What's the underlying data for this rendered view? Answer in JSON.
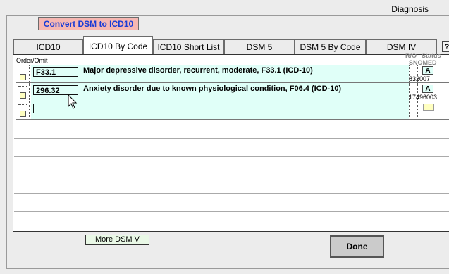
{
  "window": {
    "title": "Diagnosis"
  },
  "convert_button": {
    "label": "Convert DSM to ICD10"
  },
  "tabs": [
    {
      "label": "ICD10",
      "active": false
    },
    {
      "label": "ICD10 By Code",
      "active": true
    },
    {
      "label": "ICD10 Short List",
      "active": false
    },
    {
      "label": "DSM 5",
      "active": false
    },
    {
      "label": "DSM 5 By Code",
      "active": false
    },
    {
      "label": "DSM IV",
      "active": false
    }
  ],
  "help_button": {
    "label": "?"
  },
  "grid": {
    "headers": {
      "order_omit": "Order/Omit",
      "ro": "R/O",
      "status": "Status",
      "snomed": "SNOMED"
    },
    "rows": [
      {
        "code": "F33.1",
        "description": "Major depressive disorder, recurrent, moderate, F33.1 (ICD-10)",
        "status": "A",
        "snomed": "832007"
      },
      {
        "code": "296.32",
        "description": "Anxiety disorder due to known physiological condition, F06.4 (ICD-10)",
        "status": "A",
        "snomed": "17496003"
      },
      {
        "code": "",
        "description": "",
        "status": "",
        "snomed": ""
      }
    ]
  },
  "more_button": {
    "label": "More DSM V"
  },
  "done_button": {
    "label": "Done"
  },
  "colors": {
    "accent_row": "#e0fff8",
    "convert_bg": "#f6b7b2",
    "convert_text": "#1b3dd6"
  }
}
